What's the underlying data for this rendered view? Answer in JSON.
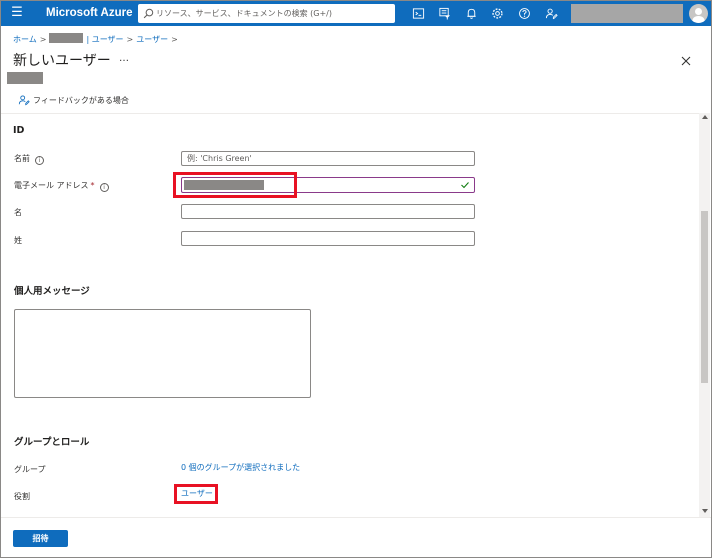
{
  "topbar": {
    "brand": "Microsoft Azure",
    "search_placeholder": "リソース、サービス、ドキュメントの検索 (G+/)",
    "icons": [
      "cloud-shell-icon",
      "directory-filter-icon",
      "notifications-icon",
      "settings-icon",
      "help-icon",
      "feedback-icon"
    ],
    "accent_color": "#0f6cbd"
  },
  "breadcrumb": {
    "home": "ホーム",
    "sep": ">",
    "users_1": "| ユーザー",
    "users_2": "ユーザー"
  },
  "header": {
    "title": "新しいユーザー",
    "more": "…",
    "feedback_label": "フィードバックがある場合"
  },
  "identity": {
    "section_title": "ID",
    "name_label": "名前",
    "name_placeholder": "例: 'Chris Green'",
    "email_label": "電子メール アドレス",
    "required_mark": "*",
    "first_name_label": "名",
    "last_name_label": "姓"
  },
  "message": {
    "section_title": "個人用メッセージ"
  },
  "groups_roles": {
    "section_title": "グループとロール",
    "groups_label": "グループ",
    "groups_value": "0 個のグループが選択されました",
    "role_label": "役割",
    "role_value": "ユーザー"
  },
  "footer": {
    "invite_label": "招待"
  },
  "highlight_color": "#e81123"
}
